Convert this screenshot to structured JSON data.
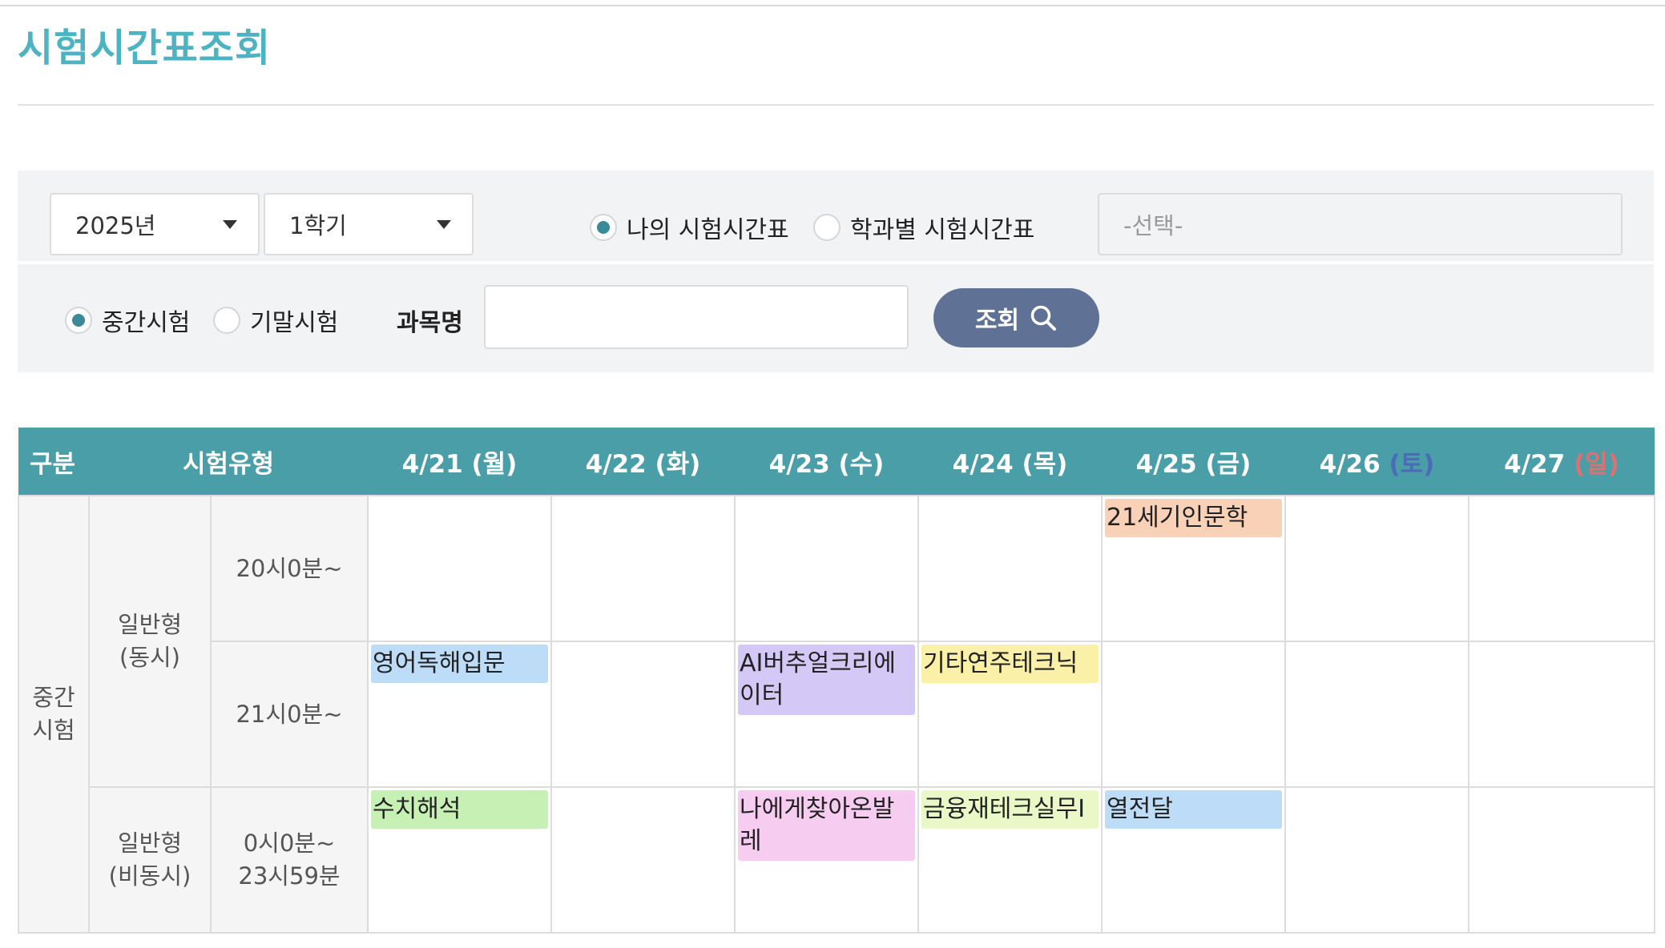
{
  "page": {
    "title": "시험시간표조회"
  },
  "filters": {
    "year": "2025년",
    "term": "1학기",
    "radio_my": "나의 시험시간표",
    "radio_dept": "학과별 시험시간표",
    "dept_placeholder": "-선택-",
    "radio_mid": "중간시험",
    "radio_final": "기말시험",
    "subject_label": "과목명",
    "subject_value": "",
    "search_label": "조회"
  },
  "table": {
    "headers": [
      "구분",
      "시험유형"
    ],
    "days": [
      {
        "date": "4/21",
        "dow": "(월)"
      },
      {
        "date": "4/22",
        "dow": "(화)"
      },
      {
        "date": "4/23",
        "dow": "(수)"
      },
      {
        "date": "4/24",
        "dow": "(목)"
      },
      {
        "date": "4/25",
        "dow": "(금)"
      },
      {
        "date": "4/26",
        "dow": "(토)"
      },
      {
        "date": "4/27",
        "dow": "(일)"
      }
    ],
    "category": "중간\n시험",
    "type_sync": "일반형\n(동시)",
    "type_async": "일반형\n(비동시)",
    "slots": [
      "20시0분~",
      "21시0분~",
      "0시0분~\n23시59분"
    ],
    "exams": {
      "slot1_fri": "21세기인문학",
      "slot2_mon": "영어독해입문",
      "slot2_wed": "AI버추얼크리에이터",
      "slot2_thu": "기타연주테크닉",
      "slot3_mon": "수치해석",
      "slot3_wed": "나에게찾아온발레",
      "slot3_thu": "금융재테크실무Ⅰ",
      "slot3_fri": "열전달"
    }
  },
  "colors": {
    "accent": "#4cb3c3",
    "header_bg": "#4a9ea8",
    "button": "#607196",
    "chip_peach": "#f9d1b6",
    "chip_blue": "#bcdcf7",
    "chip_purple": "#d4c9f6",
    "chip_yellow": "#faf0a8",
    "chip_green": "#c7f0b4",
    "chip_pink": "#f6ccf0",
    "chip_lime": "#eaf8c8"
  }
}
